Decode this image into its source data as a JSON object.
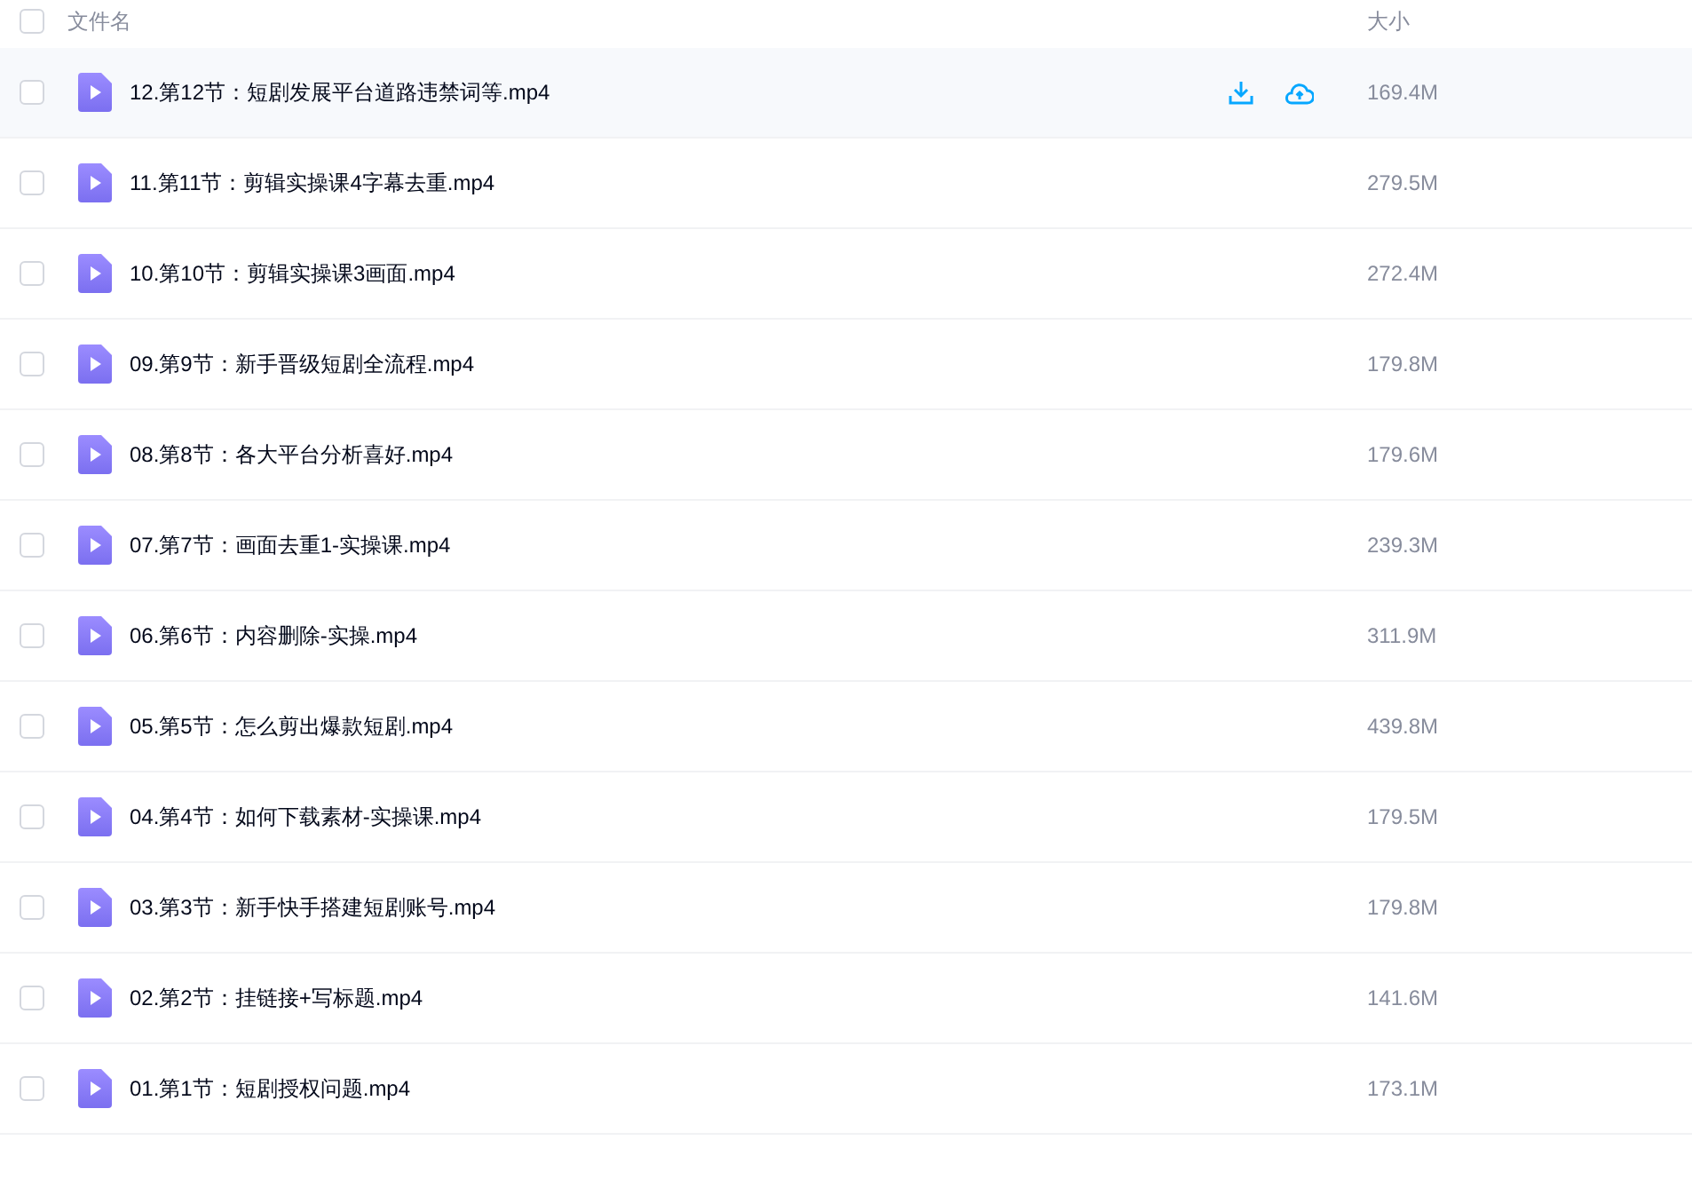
{
  "header": {
    "checked": false,
    "name": "文件名",
    "size": "大小"
  },
  "rows": [
    {
      "name": "12.第12节：短剧发展平台道路违禁词等.mp4",
      "size": "169.4M",
      "checked": false,
      "hovered": true
    },
    {
      "name": "11.第11节：剪辑实操课4字幕去重.mp4",
      "size": "279.5M",
      "checked": false,
      "hovered": false
    },
    {
      "name": "10.第10节：剪辑实操课3画面.mp4",
      "size": "272.4M",
      "checked": false,
      "hovered": false
    },
    {
      "name": "09.第9节：新手晋级短剧全流程.mp4",
      "size": "179.8M",
      "checked": false,
      "hovered": false
    },
    {
      "name": "08.第8节：各大平台分析喜好.mp4",
      "size": "179.6M",
      "checked": false,
      "hovered": false
    },
    {
      "name": "07.第7节：画面去重1-实操课.mp4",
      "size": "239.3M",
      "checked": false,
      "hovered": false
    },
    {
      "name": "06.第6节：内容删除-实操.mp4",
      "size": "311.9M",
      "checked": false,
      "hovered": false
    },
    {
      "name": "05.第5节：怎么剪出爆款短剧.mp4",
      "size": "439.8M",
      "checked": false,
      "hovered": false
    },
    {
      "name": "04.第4节：如何下载素材-实操课.mp4",
      "size": "179.5M",
      "checked": false,
      "hovered": false
    },
    {
      "name": "03.第3节：新手快手搭建短剧账号.mp4",
      "size": "179.8M",
      "checked": false,
      "hovered": false
    },
    {
      "name": "02.第2节：挂链接+写标题.mp4",
      "size": "141.6M",
      "checked": false,
      "hovered": false
    },
    {
      "name": "01.第1节：短剧授权问题.mp4",
      "size": "173.1M",
      "checked": false,
      "hovered": false
    }
  ]
}
